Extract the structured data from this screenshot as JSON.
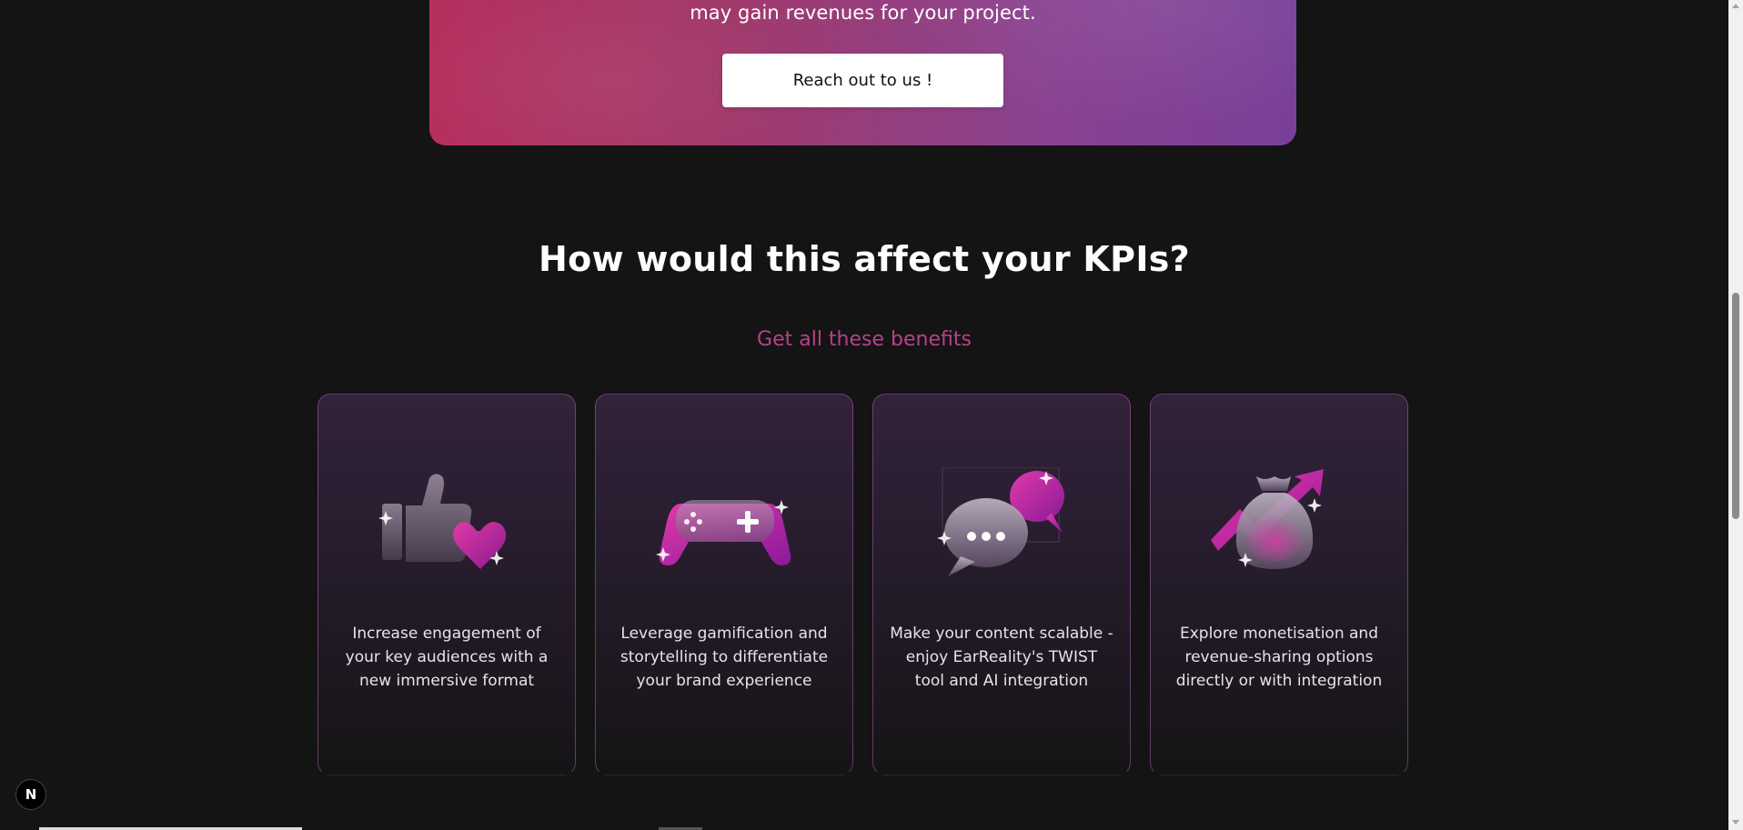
{
  "cta": {
    "text": "may gain revenues for your project.",
    "button_label": "Reach out to us !"
  },
  "kpi": {
    "title": "How would this affect your KPIs?",
    "subtitle": "Get all these benefits"
  },
  "cards": [
    {
      "icon": "thumbs-up-heart-icon",
      "text": "Increase engagement of your key audiences with a new immersive format"
    },
    {
      "icon": "game-controller-icon",
      "text": "Leverage gamification and storytelling to differentiate your brand experience"
    },
    {
      "icon": "chat-bubbles-icon",
      "text": "Make your content scalable - enjoy EarReality's TWIST tool and AI integration"
    },
    {
      "icon": "money-bag-growth-icon",
      "text": "Explore monetisation and revenue-sharing options directly or with integration"
    }
  ],
  "badge": {
    "label": "N"
  },
  "colors": {
    "accent": "#b8418a",
    "background": "#141414",
    "cta_start": "#b5305e",
    "cta_end": "#7a3f98"
  }
}
